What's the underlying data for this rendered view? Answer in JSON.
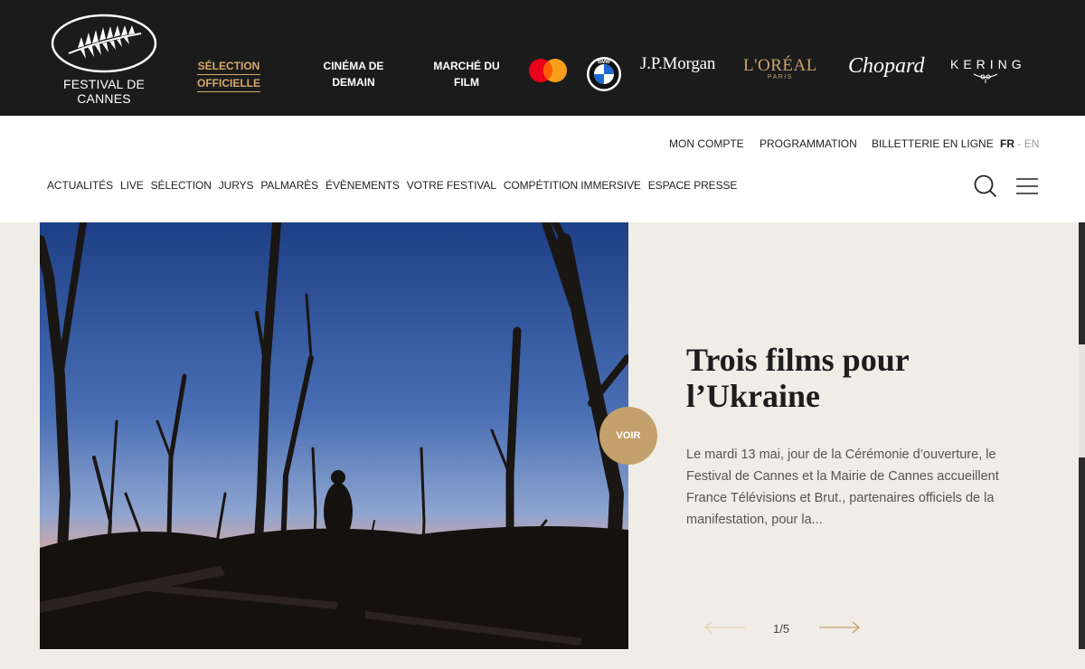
{
  "brand": {
    "logo_line1": "FESTIVAL DE",
    "logo_line2": "CANNES"
  },
  "top_nav": {
    "selection": [
      "SÉLECTION",
      "OFFICIELLE"
    ],
    "cinema": [
      "CINÉMA DE",
      "DEMAIN"
    ],
    "marche": [
      "MARCHÉ DU",
      "FILM"
    ]
  },
  "sponsors": {
    "jpmorgan": "J.P.Morgan",
    "loreal": "L'ORÉAL",
    "loreal_sub": "PARIS",
    "chopard": "Chopard",
    "kering": "KERING"
  },
  "utility_nav": {
    "account": "MON COMPTE",
    "programming": "PROGRAMMATION",
    "tickets": "BILLETTERIE EN LIGNE",
    "lang_fr": "FR",
    "lang_sep": "-",
    "lang_en": "EN"
  },
  "main_nav": [
    "ACTUALITÉS",
    "LIVE",
    "SÉLECTION",
    "JURYS",
    "PALMARÈS",
    "ÉVÈNEMENTS",
    "VOTRE FESTIVAL",
    "COMPÉTITION IMMERSIVE",
    "ESPACE PRESSE"
  ],
  "hero": {
    "button": "VOIR",
    "title": "Trois films pour l’Ukraine",
    "text": "Le mardi 13 mai, jour de la Cérémonie d’ouverture, le Festival de Cannes et la Mairie de Cannes accueillent France Télévisions et Brut., partenaires officiels de la manifestation, pour la...",
    "page": "1/5"
  },
  "colors": {
    "gold": "#c4a06c",
    "topbar": "#1b1b1b",
    "background": "#f0ece6"
  }
}
